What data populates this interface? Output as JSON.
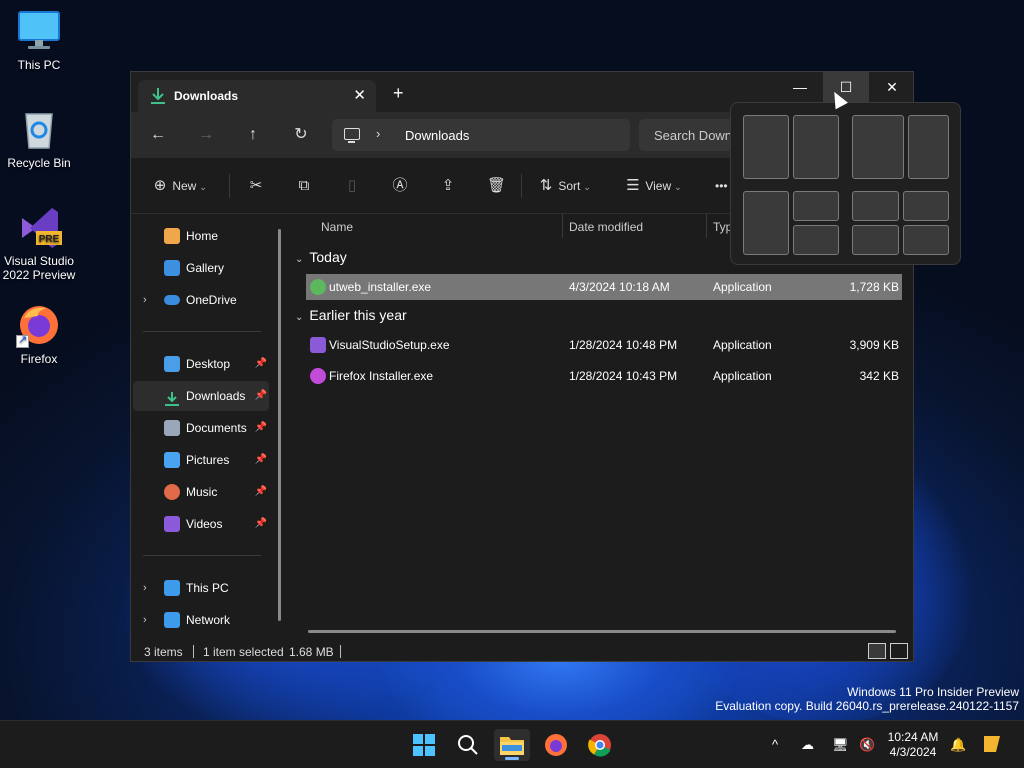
{
  "desktop": {
    "icons": [
      {
        "label": "This PC",
        "icon": "monitor-icon"
      },
      {
        "label": "Recycle Bin",
        "icon": "recycle-bin-icon"
      },
      {
        "label": "Visual Studio 2022 Preview",
        "icon": "visual-studio-preview-icon",
        "badge": "PRE"
      },
      {
        "label": "Firefox",
        "icon": "firefox-icon"
      }
    ],
    "watermark_line1": "Windows 11 Pro Insider Preview",
    "watermark_line2": "Evaluation copy. Build 26040.rs_prerelease.240122-1157"
  },
  "window": {
    "tab_title": "Downloads",
    "tab_close": "✕",
    "new_tab": "+",
    "min_glyph": "—",
    "max_glyph": "☐",
    "close_glyph": "✕",
    "nav": {
      "back": "←",
      "forward": "→",
      "up": "↑",
      "refresh": "↻"
    },
    "address": {
      "chevron": "›",
      "crumb": "Downloads"
    },
    "search": {
      "placeholder": "Search Downloads"
    },
    "commands": {
      "new": "New",
      "sort": "Sort",
      "view": "View",
      "more": "•••",
      "dropdown": "⌄"
    },
    "sidebar": {
      "items": [
        {
          "label": "Home",
          "icon": "home-icon",
          "color": "#f0a64a"
        },
        {
          "label": "Gallery",
          "icon": "gallery-icon",
          "color": "#3d8fe0"
        },
        {
          "label": "OneDrive",
          "icon": "onedrive-icon",
          "color": "#3a8dde"
        },
        {
          "label": "Desktop",
          "icon": "desktop-icon",
          "color": "#4a9ee8"
        },
        {
          "label": "Downloads",
          "icon": "downloads-icon",
          "color": "#3fc28a"
        },
        {
          "label": "Documents",
          "icon": "documents-icon",
          "color": "#9aa7b8"
        },
        {
          "label": "Pictures",
          "icon": "pictures-icon",
          "color": "#4aa3f0"
        },
        {
          "label": "Music",
          "icon": "music-icon",
          "color": "#e06a4a"
        },
        {
          "label": "Videos",
          "icon": "videos-icon",
          "color": "#8a5ad8"
        },
        {
          "label": "This PC",
          "icon": "this-pc-icon",
          "color": "#3d9be9"
        },
        {
          "label": "Network",
          "icon": "network-icon",
          "color": "#3d9be9"
        }
      ],
      "expander": "›",
      "pin": "📌"
    },
    "columns": {
      "name": "Name",
      "date": "Date modified",
      "type": "Typ"
    },
    "groups": [
      {
        "label": "Today",
        "chevron": "⌄"
      },
      {
        "label": "Earlier this year",
        "chevron": "⌄"
      }
    ],
    "files": [
      {
        "name": "utweb_installer.exe",
        "date": "4/3/2024 10:18 AM",
        "type": "Application",
        "size": "1,728 KB",
        "icon_color": "#5cb85c"
      },
      {
        "name": "VisualStudioSetup.exe",
        "date": "1/28/2024 10:48 PM",
        "type": "Application",
        "size": "3,909 KB",
        "icon_color": "#8a5ad8"
      },
      {
        "name": "Firefox Installer.exe",
        "date": "1/28/2024 10:43 PM",
        "type": "Application",
        "size": "342 KB",
        "icon_color": "#c24bd8"
      }
    ],
    "status": {
      "items": "3 items",
      "selected": "1 item selected",
      "size": "1.68 MB"
    }
  },
  "taskbar": {
    "apps": [
      {
        "name": "start",
        "icon": "windows-logo-icon"
      },
      {
        "name": "search",
        "icon": "search-icon"
      },
      {
        "name": "file-explorer",
        "icon": "folder-icon"
      },
      {
        "name": "firefox",
        "icon": "firefox-icon"
      },
      {
        "name": "chrome",
        "icon": "chrome-icon"
      }
    ],
    "tray": {
      "chevron": "^"
    },
    "time": "10:24 AM",
    "date": "4/3/2024"
  }
}
